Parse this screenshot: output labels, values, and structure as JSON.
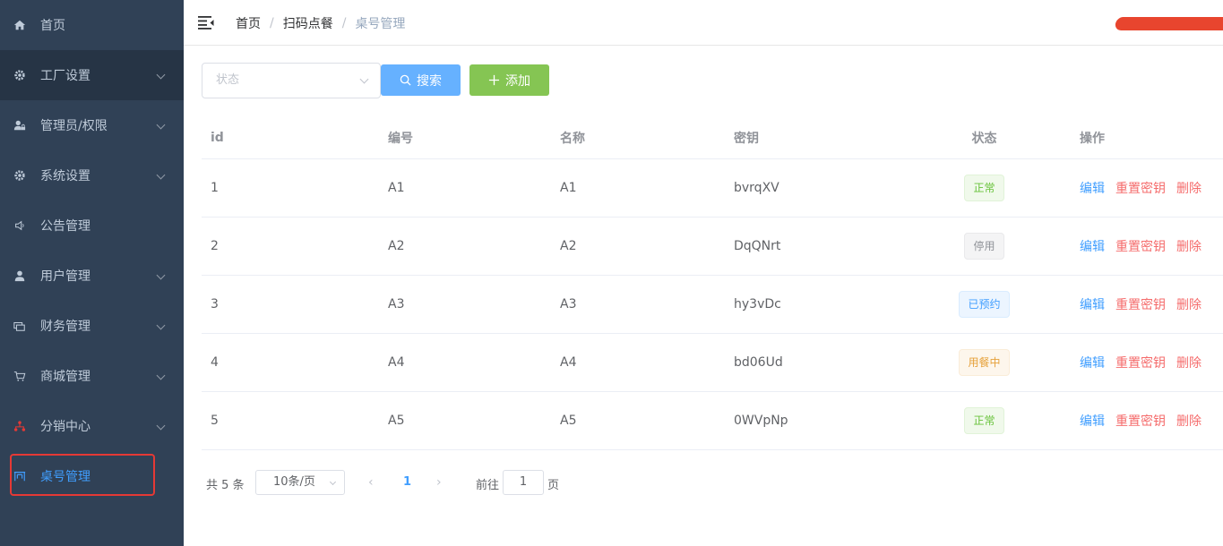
{
  "sidebar": {
    "items": [
      {
        "label": "首页",
        "icon": "home-icon",
        "has_children": false
      },
      {
        "label": "工厂设置",
        "icon": "gear-icon",
        "has_children": true
      },
      {
        "label": "管理员/权限",
        "icon": "user-lock-icon",
        "has_children": true
      },
      {
        "label": "系统设置",
        "icon": "gear-icon",
        "has_children": true
      },
      {
        "label": "公告管理",
        "icon": "speaker-icon",
        "has_children": false
      },
      {
        "label": "用户管理",
        "icon": "user-icon",
        "has_children": true
      },
      {
        "label": "财务管理",
        "icon": "money-icon",
        "has_children": true
      },
      {
        "label": "商城管理",
        "icon": "cart-icon",
        "has_children": true
      },
      {
        "label": "分销中心",
        "icon": "network-icon",
        "has_children": true
      },
      {
        "label": "桌号管理",
        "icon": "table-icon",
        "has_children": false
      }
    ],
    "active_index": 9
  },
  "header": {
    "breadcrumb": [
      "首页",
      "扫码点餐",
      "桌号管理"
    ]
  },
  "filter": {
    "status_placeholder": "状态",
    "search_label": "搜索",
    "add_label": "添加"
  },
  "table": {
    "columns": [
      "id",
      "编号",
      "名称",
      "密钥",
      "状态",
      "操作"
    ],
    "rows": [
      {
        "id": "1",
        "code": "A1",
        "name": "A1",
        "key": "bvrqXV",
        "status": "正常"
      },
      {
        "id": "2",
        "code": "A2",
        "name": "A2",
        "key": "DqQNrt",
        "status": "停用"
      },
      {
        "id": "3",
        "code": "A3",
        "name": "A3",
        "key": "hy3vDc",
        "status": "已预约"
      },
      {
        "id": "4",
        "code": "A4",
        "name": "A4",
        "key": "bd06Ud",
        "status": "用餐中"
      },
      {
        "id": "5",
        "code": "A5",
        "name": "A5",
        "key": "0WVpNp",
        "status": "正常"
      }
    ],
    "actions": {
      "edit": "编辑",
      "reset_key": "重置密钥",
      "delete": "删除"
    }
  },
  "pagination": {
    "total_text": "共 5 条",
    "page_size": "10条/页",
    "current_page": "1",
    "goto_label": "前往",
    "goto_value": "1",
    "page_unit": "页"
  },
  "colors": {
    "sidebar_bg": "#304156",
    "primary": "#409eff",
    "success": "#67c23a",
    "danger": "#f56c6c",
    "highlight_outline": "#e53935"
  }
}
